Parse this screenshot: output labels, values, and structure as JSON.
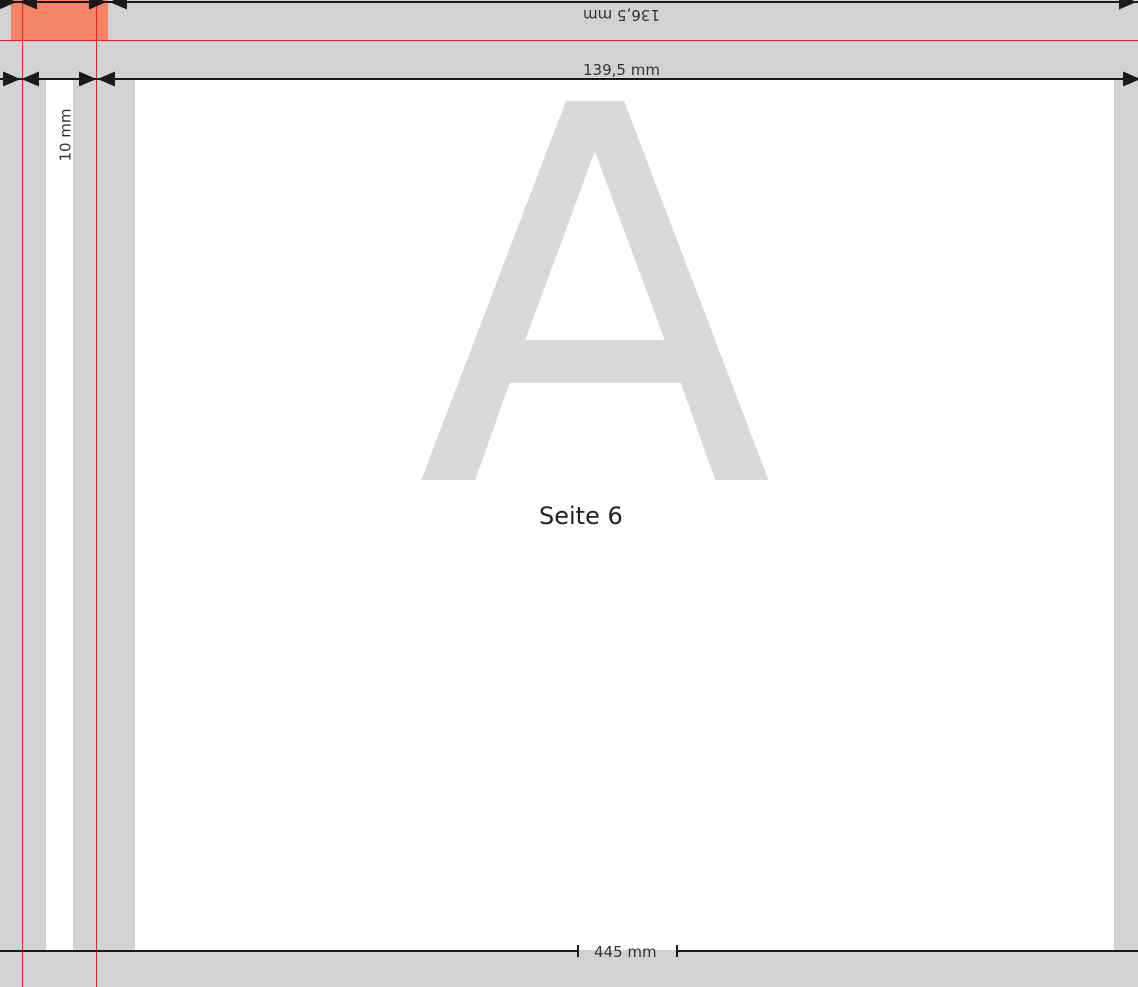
{
  "dimensions": {
    "top_label": "136,5 mm",
    "width_label": "139,5 mm",
    "side_label": "10 mm",
    "bottom_label": "445 mm"
  },
  "page": {
    "letter": "A",
    "caption": "Seite 6"
  },
  "colors": {
    "bleed": "#d1d2d4",
    "paper": "#ffffff",
    "guide_line": "#e5222a",
    "highlight": "#f58466",
    "letter": "#d9d9db"
  }
}
